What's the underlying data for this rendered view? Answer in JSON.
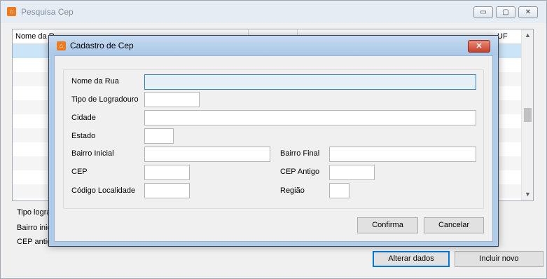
{
  "background_window": {
    "title": "Pesquisa Cep",
    "window_buttons": {
      "minimize": "▭",
      "maximize": "▢",
      "close": "✕"
    },
    "grid": {
      "header_first": "Nome da R",
      "header_last": "UF"
    },
    "labels": {
      "tipo": "Tipo logra",
      "bairro": "Bairro inic",
      "cep": "CEP antig"
    },
    "buttons": {
      "alterar": "Alterar dados",
      "incluir": "Incluir novo"
    }
  },
  "dialog": {
    "title": "Cadastro de Cep",
    "close_glyph": "✕",
    "fields": {
      "nome_rua": {
        "label": "Nome da Rua",
        "value": ""
      },
      "tipo": {
        "label": "Tipo de Logradouro",
        "value": ""
      },
      "cidade": {
        "label": "Cidade",
        "value": ""
      },
      "estado": {
        "label": "Estado",
        "value": ""
      },
      "bairro_ini": {
        "label": "Bairro Inicial",
        "value": ""
      },
      "bairro_fim": {
        "label": "Bairro Final",
        "value": ""
      },
      "cep": {
        "label": "CEP",
        "value": ""
      },
      "cep_antigo": {
        "label": "CEP Antigo",
        "value": ""
      },
      "cod_local": {
        "label": "Código Localidade",
        "value": ""
      },
      "regiao": {
        "label": "Região",
        "value": ""
      }
    },
    "buttons": {
      "confirma": "Confirma",
      "cancelar": "Cancelar"
    }
  },
  "colors": {
    "app_icon": "#f07b1e",
    "selection": "#cce4f7",
    "close_red": "#c7412c"
  }
}
